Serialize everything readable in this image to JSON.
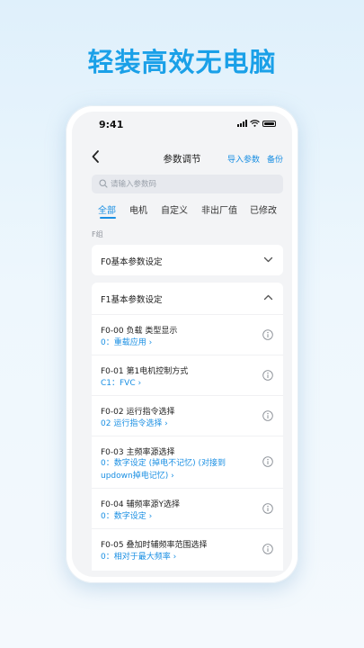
{
  "headline": "轻装高效无电脑",
  "status_bar": {
    "time": "9:41"
  },
  "nav": {
    "title": "参数调节",
    "import_label": "导入参数",
    "backup_label": "备份"
  },
  "search": {
    "placeholder": "请输入参数码",
    "value": ""
  },
  "tabs": [
    {
      "label": "全部",
      "active": true
    },
    {
      "label": "电机",
      "active": false
    },
    {
      "label": "自定义",
      "active": false
    },
    {
      "label": "非出厂值",
      "active": false
    },
    {
      "label": "已修改",
      "active": false
    }
  ],
  "group_label": "F组",
  "groups": [
    {
      "title": "F0基本参数设定",
      "expanded": false
    },
    {
      "title": "F1基本参数设定",
      "expanded": true
    }
  ],
  "params": [
    {
      "name": "F0-00 负载 类型显示",
      "value": "0：重载应用 ›"
    },
    {
      "name": "F0-01 第1电机控制方式",
      "value": "C1：FVC ›"
    },
    {
      "name": "F0-02 运行指令选择",
      "value": "02 运行指令选择 ›"
    },
    {
      "name": "F0-03 主频率源选择",
      "value": "0：数字设定 (掉电不记忆) (对接到updown掉电记忆) ›"
    },
    {
      "name": "F0-04 辅频率源Y选择",
      "value": "0：数字设定 ›"
    },
    {
      "name": "F0-05 叠加时辅频率范围选择",
      "value": "0：相对于最大频率 ›"
    }
  ],
  "colors": {
    "accent": "#1a8fe3",
    "headline": "#1aa0e8",
    "background": "#e6f3fc"
  }
}
